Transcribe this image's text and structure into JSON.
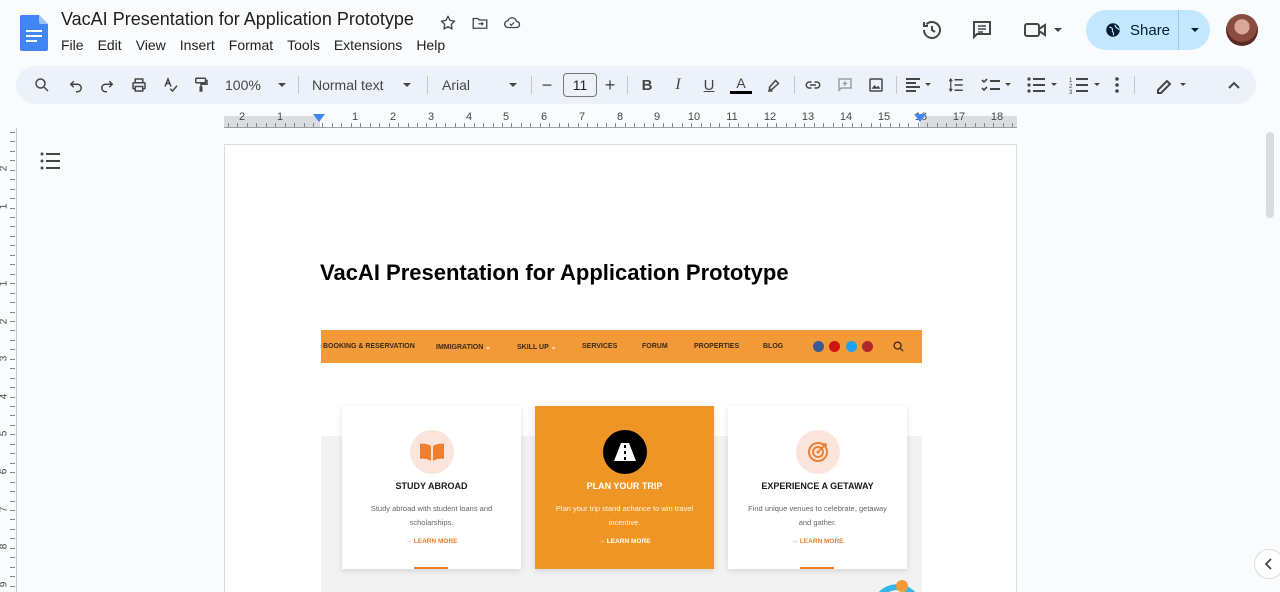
{
  "doc": {
    "title": "VacAI Presentation for Application Prototype",
    "heading": "VacAI Presentation for Application Prototype"
  },
  "menu": [
    "File",
    "Edit",
    "View",
    "Insert",
    "Format",
    "Tools",
    "Extensions",
    "Help"
  ],
  "toolbar": {
    "zoom": "100%",
    "style": "Normal text",
    "font": "Arial",
    "font_size": "11"
  },
  "share": {
    "label": "Share"
  },
  "ruler": {
    "numbers": [
      "2",
      "1",
      "1",
      "2",
      "3",
      "4",
      "5",
      "6",
      "7",
      "8",
      "9",
      "10",
      "11",
      "12",
      "13",
      "14",
      "15",
      "16",
      "17",
      "18"
    ]
  },
  "vruler": {
    "numbers": [
      "2",
      "1",
      "1",
      "2",
      "3",
      "4",
      "5",
      "6",
      "7",
      "8",
      "9"
    ]
  },
  "embed": {
    "nav": [
      "BOOKING & RESERVATION",
      "IMMIGRATION",
      "SKILL UP",
      "SERVICES",
      "FORUM",
      "PROPERTIES",
      "BLOG"
    ],
    "cards": [
      {
        "title": "STUDY ABROAD",
        "desc": "Study abroad with student loans and scholarships.",
        "link": "LEARN MORE"
      },
      {
        "title": "PLAN YOUR TRIP",
        "desc": "Plan your trip stand achance to win travel incentive.",
        "link": "LEARN MORE"
      },
      {
        "title": "EXPERIENCE A GETAWAY",
        "desc": "Find unique venues to celebrate, getaway and gather.",
        "link": "LEARN MORE"
      }
    ]
  },
  "colors": {
    "accent": "#0b57d0",
    "share_bg": "#c2e7ff",
    "embed_orange": "#f29a38"
  }
}
